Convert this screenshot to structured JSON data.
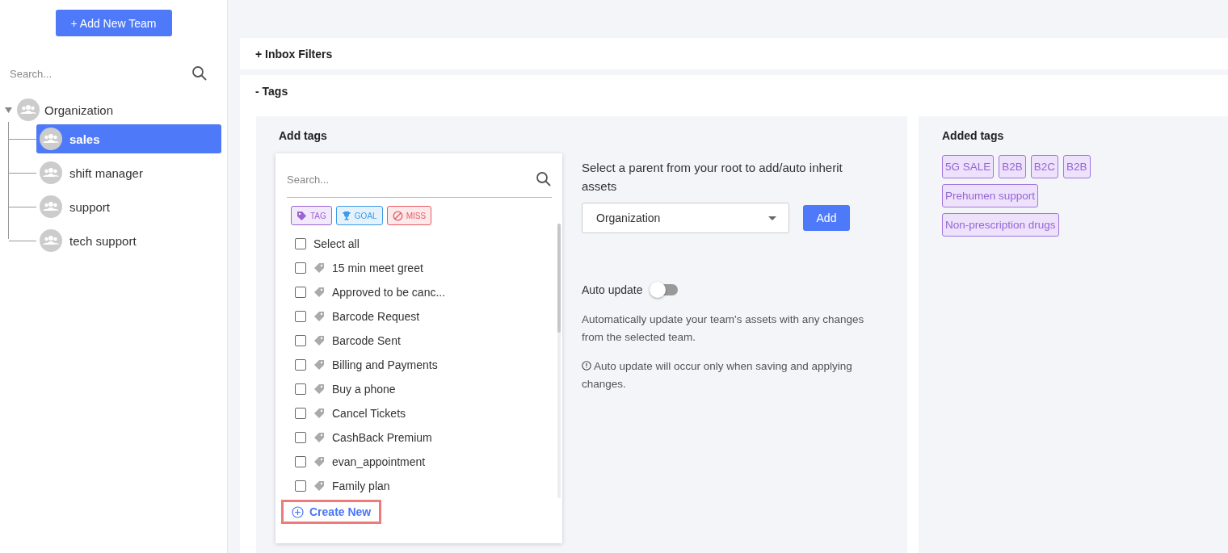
{
  "sidebar": {
    "add_button": "+ Add New Team",
    "search": {
      "placeholder": "Search..."
    },
    "tree": [
      {
        "label": "Organization",
        "expanded": true,
        "children": [
          {
            "label": "sales",
            "selected": true
          },
          {
            "label": "shift manager",
            "selected": false
          },
          {
            "label": "support",
            "selected": false
          },
          {
            "label": "tech support",
            "selected": false
          }
        ]
      }
    ]
  },
  "sections": [
    {
      "label": "+ Inbox Filters",
      "expanded": false
    },
    {
      "label": "- Tags",
      "expanded": true
    }
  ],
  "add_tags": {
    "title": "Add tags",
    "picker": {
      "search": {
        "placeholder": "Search..."
      },
      "filters": [
        {
          "label": "TAG",
          "kind": "tag",
          "color": "#9b63d6"
        },
        {
          "label": "GOAL",
          "kind": "goal",
          "color": "#3d9be9"
        },
        {
          "label": "MISS",
          "kind": "miss",
          "color": "#ea5a64"
        }
      ],
      "select_all": {
        "label": "Select all",
        "checked": false
      },
      "items": [
        {
          "label": "15 min meet greet",
          "checked": false
        },
        {
          "label": "Approved to be canc...",
          "checked": false
        },
        {
          "label": "Barcode Request",
          "checked": false
        },
        {
          "label": "Barcode Sent",
          "checked": false
        },
        {
          "label": "Billing and Payments",
          "checked": false
        },
        {
          "label": "Buy a phone",
          "checked": false
        },
        {
          "label": "Cancel Tickets",
          "checked": false
        },
        {
          "label": "CashBack Premium",
          "checked": false
        },
        {
          "label": "evan_appointment",
          "checked": false
        },
        {
          "label": "Family plan",
          "checked": false
        }
      ],
      "create_new": "Create New"
    },
    "parent_prompt": "Select a parent from your root to add/auto inherit assets",
    "parent_select": {
      "value": "Organization"
    },
    "add_button": "Add",
    "auto_update": {
      "label": "Auto update",
      "on": false
    },
    "description": "Automatically update your team's assets with any changes from the selected team.",
    "note": "Auto update will occur only when saving and applying changes."
  },
  "added_tags": {
    "title": "Added tags",
    "tags": [
      "5G SALE",
      "B2B",
      "B2C",
      "B2B",
      "Prehumen support",
      "Non-prescription drugs"
    ]
  }
}
